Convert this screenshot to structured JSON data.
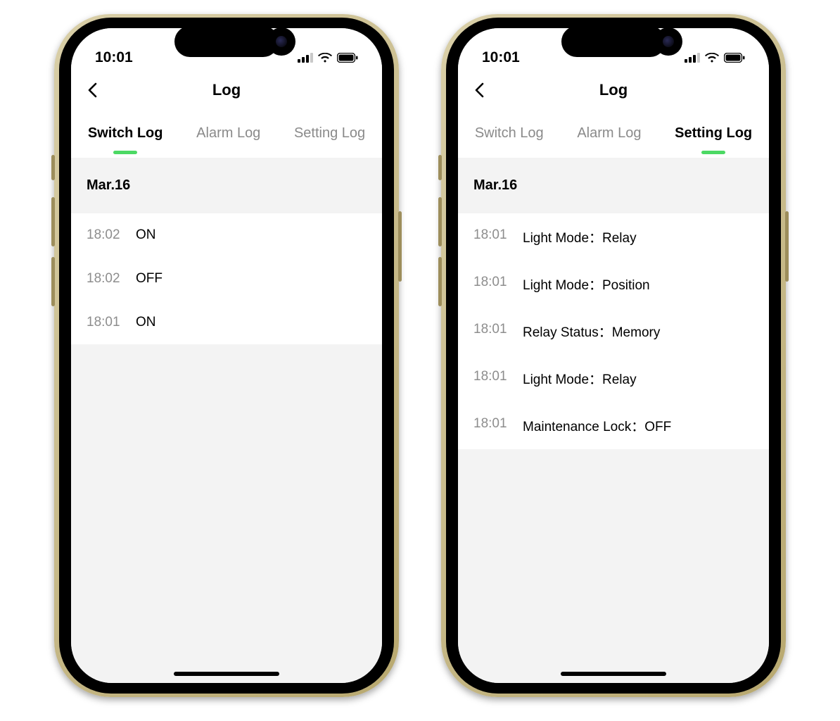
{
  "status": {
    "time": "10:01"
  },
  "nav": {
    "title": "Log"
  },
  "tabs": {
    "switch": "Switch Log",
    "alarm": "Alarm Log",
    "setting": "Setting Log"
  },
  "phones": [
    {
      "active_tab": "switch",
      "date": "Mar.16",
      "rows": [
        {
          "time": "18:02",
          "text": "ON"
        },
        {
          "time": "18:02",
          "text": "OFF"
        },
        {
          "time": "18:01",
          "text": "ON"
        }
      ]
    },
    {
      "active_tab": "setting",
      "date": "Mar.16",
      "rows": [
        {
          "time": "18:01",
          "text": "Light Mode：Relay"
        },
        {
          "time": "18:01",
          "text": "Light Mode：Position"
        },
        {
          "time": "18:01",
          "text": "Relay Status：Memory"
        },
        {
          "time": "18:01",
          "text": "Light Mode：Relay"
        },
        {
          "time": "18:01",
          "text": "Maintenance Lock：OFF"
        }
      ]
    }
  ]
}
